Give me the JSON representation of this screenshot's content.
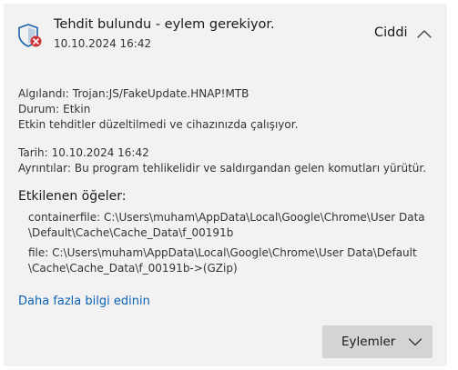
{
  "header": {
    "title": "Tehdit bulundu - eylem gerekiyor.",
    "date": "10.10.2024 16:42",
    "severity": "Ciddi",
    "collapse_icon": "chevron-up-icon",
    "shield_icon": "shield-alert-icon"
  },
  "details": {
    "detected_label": "Algılandı:",
    "detected_value": "Trojan:JS/FakeUpdate.HNAP!MTB",
    "status_label": "Durum:",
    "status_value": "Etkin",
    "status_note": "Etkin tehditler düzeltilmedi ve cihazınızda çalışıyor.",
    "date_label": "Tarih:",
    "date_value": "10.10.2024 16:42",
    "details_label": "Ayrıntılar:",
    "details_value": "Bu program tehlikelidir ve saldırgandan gelen komutları yürütür."
  },
  "affected": {
    "title": "Etkilenen öğeler:",
    "items": [
      {
        "line1": "containerfile: C:\\Users\\muham\\AppData\\Local\\Google\\Chrome\\User Data",
        "line2": "\\Default\\Cache\\Cache_Data\\f_00191b"
      },
      {
        "line1": "file: C:\\Users\\muham\\AppData\\Local\\Google\\Chrome\\User Data\\Default",
        "line2": "\\Cache\\Cache_Data\\f_00191b->(GZip)"
      }
    ]
  },
  "learn_more": "Daha fazla bilgi edinin",
  "actions": {
    "label": "Eylemler",
    "icon": "chevron-down-icon"
  },
  "colors": {
    "card_bg": "#f2f2f2",
    "link": "#0b62b5",
    "shield_blue": "#1c5fa8",
    "alert_red": "#d13438",
    "button_bg": "#d4d4d4"
  }
}
